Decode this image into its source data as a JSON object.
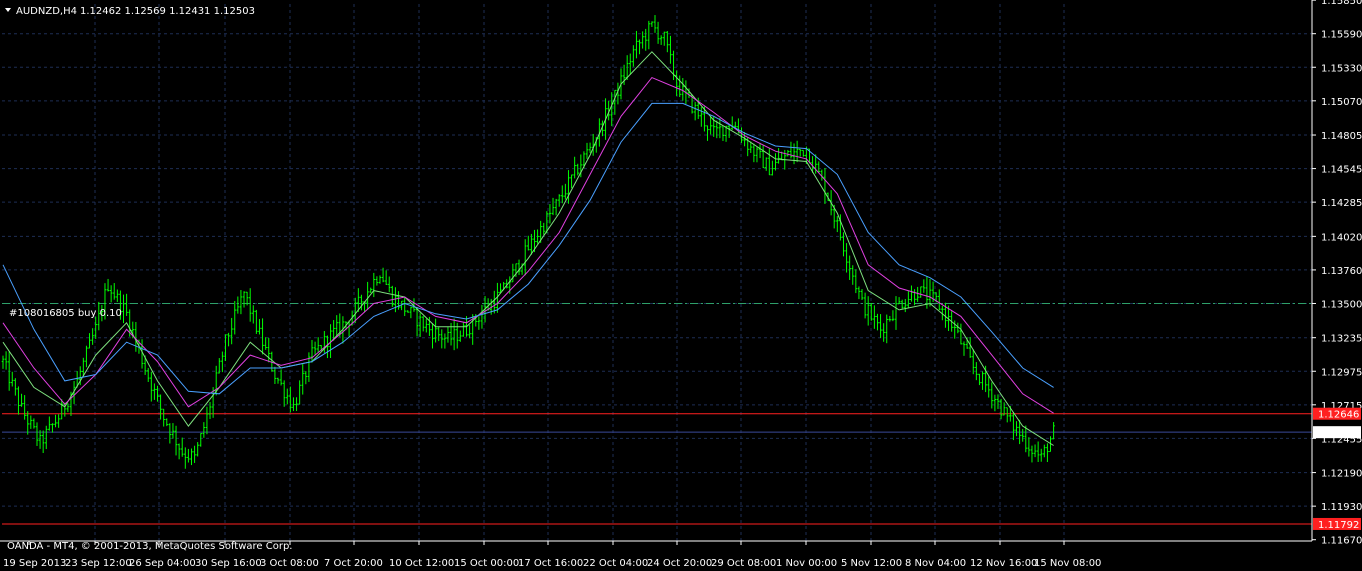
{
  "header": {
    "symbol_label": "AUDNZD,H4",
    "ohlc": "1.12462 1.12569 1.12431 1.12503"
  },
  "footer": {
    "copyright": "OANDA - MT4, © 2001-2013, MetaQuotes Software Corp."
  },
  "colors": {
    "background": "#000000",
    "grid": "#1e2e54",
    "axis": "#ffffff",
    "candle": "#00ff00",
    "ma_fast": "#7ee07e",
    "ma_mid": "#e040e0",
    "ma_slow": "#4aa0ff",
    "order_line": "#2ea06a",
    "red_level": "#ff2020",
    "bid_line": "#3a4a9a"
  },
  "chart_data": {
    "type": "candlestick",
    "symbol": "AUDNZD",
    "timeframe": "H4",
    "ylim": [
      1.1166,
      1.1582
    ],
    "yticks": [
      "1.15850",
      "1.15590",
      "1.15330",
      "1.15070",
      "1.14805",
      "1.14545",
      "1.14285",
      "1.14020",
      "1.13760",
      "1.13500",
      "1.13235",
      "1.12975",
      "1.12715",
      "1.12455",
      "1.12190",
      "1.11930",
      "1.11670"
    ],
    "xticks": [
      "19 Sep 2013",
      "23 Sep 12:00",
      "26 Sep 04:00",
      "30 Sep 16:00",
      "3 Oct 08:00",
      "7 Oct 20:00",
      "10 Oct 12:00",
      "15 Oct 00:00",
      "17 Oct 16:00",
      "22 Oct 04:00",
      "24 Oct 20:00",
      "29 Oct 08:00",
      "1 Nov 00:00",
      "5 Nov 12:00",
      "8 Nov 04:00",
      "12 Nov 16:00",
      "15 Nov 08:00"
    ],
    "price_path": [
      [
        0,
        1.1305
      ],
      [
        6,
        1.1268
      ],
      [
        12,
        1.1242
      ],
      [
        18,
        1.1262
      ],
      [
        24,
        1.129
      ],
      [
        30,
        1.133
      ],
      [
        34,
        1.1365
      ],
      [
        40,
        1.1342
      ],
      [
        46,
        1.13
      ],
      [
        52,
        1.1262
      ],
      [
        58,
        1.1235
      ],
      [
        62,
        1.123
      ],
      [
        66,
        1.1262
      ],
      [
        72,
        1.132
      ],
      [
        78,
        1.1358
      ],
      [
        82,
        1.1332
      ],
      [
        88,
        1.1295
      ],
      [
        94,
        1.127
      ],
      [
        100,
        1.131
      ],
      [
        106,
        1.1325
      ],
      [
        112,
        1.1338
      ],
      [
        118,
        1.136
      ],
      [
        122,
        1.1375
      ],
      [
        126,
        1.1355
      ],
      [
        132,
        1.1342
      ],
      [
        138,
        1.133
      ],
      [
        144,
        1.1322
      ],
      [
        150,
        1.133
      ],
      [
        156,
        1.1345
      ],
      [
        162,
        1.136
      ],
      [
        168,
        1.1385
      ],
      [
        174,
        1.1408
      ],
      [
        180,
        1.143
      ],
      [
        186,
        1.1455
      ],
      [
        192,
        1.148
      ],
      [
        198,
        1.151
      ],
      [
        204,
        1.1545
      ],
      [
        210,
        1.1565
      ],
      [
        214,
        1.1555
      ],
      [
        218,
        1.152
      ],
      [
        224,
        1.15
      ],
      [
        230,
        1.1482
      ],
      [
        236,
        1.149
      ],
      [
        242,
        1.147
      ],
      [
        248,
        1.1455
      ],
      [
        254,
        1.1465
      ],
      [
        260,
        1.147
      ],
      [
        266,
        1.144
      ],
      [
        272,
        1.1395
      ],
      [
        278,
        1.135
      ],
      [
        284,
        1.133
      ],
      [
        290,
        1.135
      ],
      [
        296,
        1.136
      ],
      [
        302,
        1.1352
      ],
      [
        308,
        1.133
      ],
      [
        314,
        1.13
      ],
      [
        320,
        1.128
      ],
      [
        326,
        1.1258
      ],
      [
        332,
        1.124
      ],
      [
        336,
        1.123
      ],
      [
        340,
        1.125
      ]
    ],
    "moving_averages": [
      {
        "role": "fast",
        "points": [
          [
            0,
            1.132
          ],
          [
            10,
            1.1285
          ],
          [
            20,
            1.127
          ],
          [
            30,
            1.131
          ],
          [
            40,
            1.1335
          ],
          [
            50,
            1.129
          ],
          [
            60,
            1.1255
          ],
          [
            70,
            1.1285
          ],
          [
            80,
            1.132
          ],
          [
            90,
            1.13
          ],
          [
            100,
            1.1305
          ],
          [
            110,
            1.133
          ],
          [
            120,
            1.136
          ],
          [
            130,
            1.1355
          ],
          [
            140,
            1.1332
          ],
          [
            150,
            1.1332
          ],
          [
            160,
            1.1355
          ],
          [
            170,
            1.1385
          ],
          [
            180,
            1.142
          ],
          [
            190,
            1.1465
          ],
          [
            200,
            1.152
          ],
          [
            210,
            1.1545
          ],
          [
            220,
            1.152
          ],
          [
            230,
            1.1492
          ],
          [
            240,
            1.1478
          ],
          [
            250,
            1.1462
          ],
          [
            260,
            1.146
          ],
          [
            270,
            1.142
          ],
          [
            280,
            1.136
          ],
          [
            290,
            1.1345
          ],
          [
            300,
            1.135
          ],
          [
            310,
            1.133
          ],
          [
            320,
            1.129
          ],
          [
            330,
            1.1255
          ],
          [
            340,
            1.124
          ]
        ]
      },
      {
        "role": "mid",
        "points": [
          [
            0,
            1.1335
          ],
          [
            10,
            1.13
          ],
          [
            20,
            1.1272
          ],
          [
            30,
            1.1295
          ],
          [
            40,
            1.133
          ],
          [
            50,
            1.1305
          ],
          [
            60,
            1.127
          ],
          [
            70,
            1.1285
          ],
          [
            80,
            1.131
          ],
          [
            90,
            1.1302
          ],
          [
            100,
            1.1308
          ],
          [
            110,
            1.1328
          ],
          [
            120,
            1.135
          ],
          [
            130,
            1.1355
          ],
          [
            140,
            1.134
          ],
          [
            150,
            1.1335
          ],
          [
            160,
            1.135
          ],
          [
            170,
            1.1375
          ],
          [
            180,
            1.1405
          ],
          [
            190,
            1.145
          ],
          [
            200,
            1.1495
          ],
          [
            210,
            1.1525
          ],
          [
            220,
            1.1515
          ],
          [
            230,
            1.1498
          ],
          [
            240,
            1.148
          ],
          [
            250,
            1.1468
          ],
          [
            260,
            1.1462
          ],
          [
            270,
            1.1435
          ],
          [
            280,
            1.138
          ],
          [
            290,
            1.1362
          ],
          [
            300,
            1.1355
          ],
          [
            310,
            1.134
          ],
          [
            320,
            1.131
          ],
          [
            330,
            1.128
          ],
          [
            340,
            1.1265
          ]
        ]
      },
      {
        "role": "slow",
        "points": [
          [
            0,
            1.138
          ],
          [
            10,
            1.133
          ],
          [
            20,
            1.129
          ],
          [
            30,
            1.1295
          ],
          [
            40,
            1.132
          ],
          [
            50,
            1.131
          ],
          [
            60,
            1.1282
          ],
          [
            70,
            1.128
          ],
          [
            80,
            1.13
          ],
          [
            90,
            1.13
          ],
          [
            100,
            1.1305
          ],
          [
            110,
            1.132
          ],
          [
            120,
            1.134
          ],
          [
            130,
            1.135
          ],
          [
            140,
            1.1342
          ],
          [
            150,
            1.1338
          ],
          [
            160,
            1.1345
          ],
          [
            170,
            1.1365
          ],
          [
            180,
            1.1395
          ],
          [
            190,
            1.143
          ],
          [
            200,
            1.1475
          ],
          [
            210,
            1.1505
          ],
          [
            220,
            1.1505
          ],
          [
            230,
            1.1495
          ],
          [
            240,
            1.1482
          ],
          [
            250,
            1.1472
          ],
          [
            260,
            1.147
          ],
          [
            270,
            1.145
          ],
          [
            280,
            1.1405
          ],
          [
            290,
            1.138
          ],
          [
            300,
            1.137
          ],
          [
            310,
            1.1355
          ],
          [
            320,
            1.1328
          ],
          [
            330,
            1.13
          ],
          [
            340,
            1.1285
          ]
        ]
      }
    ],
    "order_line": {
      "label": "#108016805 buy 0.10",
      "price": 1.135
    },
    "red_levels": [
      {
        "price": 1.12646,
        "label": "1.12646"
      },
      {
        "price": 1.11792,
        "label": "1.11792"
      }
    ],
    "bid_line": {
      "price": 1.12503,
      "label": "1.12503"
    },
    "grid": true
  }
}
